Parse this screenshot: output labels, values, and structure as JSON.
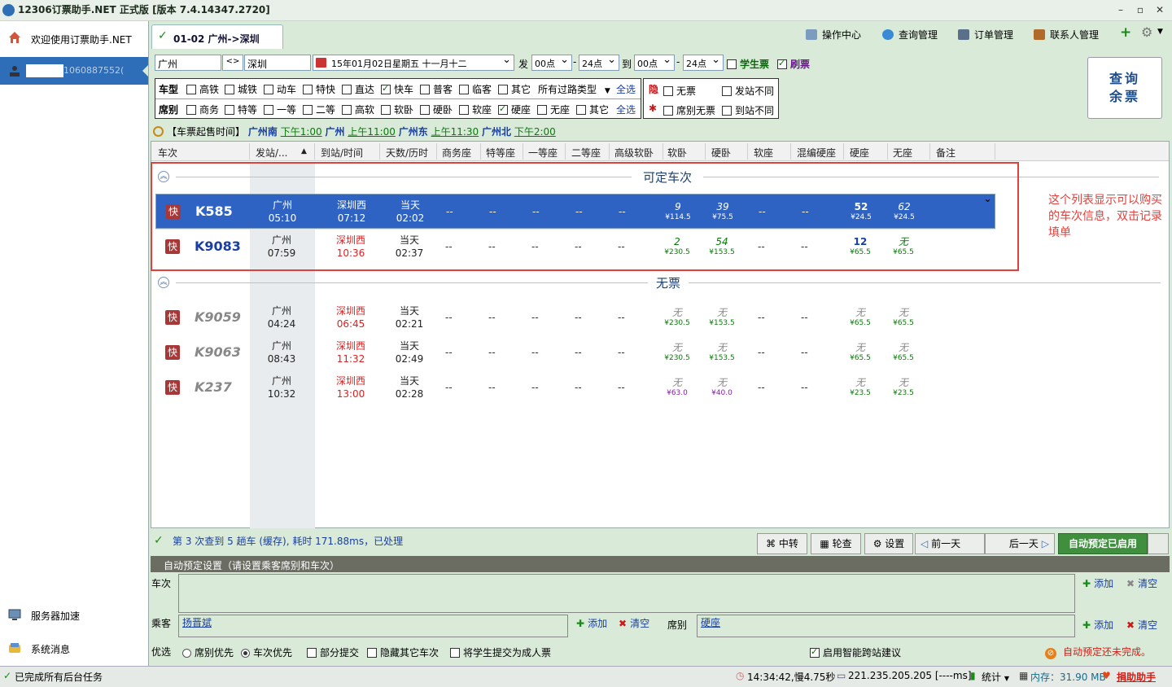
{
  "app": {
    "title": "12306订票助手.NET   正式版 [版本 7.4.14347.2720]"
  },
  "sidebar": {
    "welcome": "欢迎使用订票助手.NET",
    "user_phone": "1060887552(",
    "server_accel": "服务器加速",
    "sys_msg": "系统消息"
  },
  "tab": {
    "label": "01-02 广州->深圳"
  },
  "toolbar": {
    "ops_center": "操作中心",
    "query_mgmt": "查询管理",
    "order_mgmt": "订单管理",
    "contacts_mgmt": "联系人管理"
  },
  "query": {
    "from": "广州",
    "swap": "<>",
    "to": "深圳",
    "date": "15年01月02日星期五  十一月十二",
    "dep_label": "发",
    "dep_start": "00点",
    "dep_end": "24点",
    "arr_label": "到",
    "arr_start": "00点",
    "arr_end": "24点",
    "student": "学生票",
    "refresh": "刷票",
    "button_line1": "查询",
    "button_line2": "余票"
  },
  "filters": {
    "type_label": "车型",
    "types": [
      "高铁",
      "城铁",
      "动车",
      "特快",
      "直达",
      "快车",
      "普客",
      "临客",
      "其它"
    ],
    "transit_type": "所有过路类型",
    "select_all": "全选",
    "seat_label": "席别",
    "seats": [
      "商务",
      "特等",
      "一等",
      "二等",
      "高软",
      "软卧",
      "硬卧",
      "软座",
      "硬座",
      "无座",
      "其它"
    ],
    "hide_label": "隐",
    "opt_no_ticket": "无票",
    "opt_dep_diff": "发站不同",
    "opt_seat_none": "席别无票",
    "opt_arr_diff": "到站不同"
  },
  "sale_info": {
    "prefix": "【车票起售时间】",
    "stations": [
      {
        "name": "广州南",
        "time": "下午1:00"
      },
      {
        "name": "广州",
        "time": "上午11:00"
      },
      {
        "name": "广州东",
        "time": "上午11:30"
      },
      {
        "name": "广州北",
        "time": "下午2:00"
      }
    ]
  },
  "grid": {
    "headers": [
      "车次",
      "发站/...",
      "到站/时间",
      "天数/历时",
      "商务座",
      "特等座",
      "一等座",
      "二等座",
      "高级软卧",
      "软卧",
      "硬卧",
      "软座",
      "混编硬座",
      "硬座",
      "无座",
      "备注"
    ],
    "section_available": "可定车次",
    "section_none": "无票",
    "dash": "--",
    "badge": "快",
    "trains_available": [
      {
        "no": "K585",
        "from": "广州",
        "dep": "05:10",
        "to": "深圳西",
        "arr": "07:12",
        "day": "当天",
        "dur": "02:02",
        "rw": "9",
        "rw_p": "¥114.5",
        "yw": "39",
        "yw_p": "¥75.5",
        "yz": "52",
        "yz_p": "¥24.5",
        "wz": "62",
        "wz_p": "¥24.5"
      },
      {
        "no": "K9083",
        "from": "广州",
        "dep": "07:59",
        "to": "深圳西",
        "arr": "10:36",
        "day": "当天",
        "dur": "02:37",
        "rw": "2",
        "rw_p": "¥230.5",
        "yw": "54",
        "yw_p": "¥153.5",
        "yz": "12",
        "yz_p": "¥65.5",
        "wz": "无",
        "wz_p": "¥65.5"
      }
    ],
    "trains_none": [
      {
        "no": "K9059",
        "from": "广州",
        "dep": "04:24",
        "to": "深圳西",
        "arr": "06:45",
        "day": "当天",
        "dur": "02:21",
        "rw": "无",
        "rw_p": "¥230.5",
        "yw": "无",
        "yw_p": "¥153.5",
        "yz": "无",
        "yz_p": "¥65.5",
        "wz": "无",
        "wz_p": "¥65.5"
      },
      {
        "no": "K9063",
        "from": "广州",
        "dep": "08:43",
        "to": "深圳西",
        "arr": "11:32",
        "day": "当天",
        "dur": "02:49",
        "rw": "无",
        "rw_p": "¥230.5",
        "yw": "无",
        "yw_p": "¥153.5",
        "yz": "无",
        "yz_p": "¥65.5",
        "wz": "无",
        "wz_p": "¥65.5"
      },
      {
        "no": "K237",
        "from": "广州",
        "dep": "10:32",
        "to": "深圳西",
        "arr": "13:00",
        "day": "当天",
        "dur": "02:28",
        "rw": "无",
        "rw_p": "¥63.0",
        "yw": "无",
        "yw_p": "¥40.0",
        "yz": "无",
        "yz_p": "¥23.5",
        "wz": "无",
        "wz_p": "¥23.5"
      }
    ]
  },
  "annotation": "这个列表显示可以购买的车次信息，双击记录填单",
  "grid_status": "第 3 次查到 5 趟车 (缓存), 耗时 171.88ms，已处理",
  "grid_toolbar": {
    "transfer": "中转",
    "round": "轮查",
    "settings": "设置",
    "prev_day": "前一天",
    "next_day": "后一天",
    "auto_book": "自动预定已启用"
  },
  "auto": {
    "header": "自动预定设置（请设置乘客席别和车次）",
    "train_label": "车次",
    "passenger_label": "乘客",
    "passenger_value": "扬晋斌",
    "seat_label": "席别",
    "seat_value": "硬座",
    "add": "添加",
    "clear": "清空",
    "priority_label": "优选",
    "opt_seat_first": "席别优先",
    "opt_train_first": "车次优先",
    "opt_partial": "部分提交",
    "opt_hide_other": "隐藏其它车次",
    "opt_student_adult": "将学生提交为成人票",
    "opt_smart": "启用智能跨站建议",
    "warning": "自动预定还未完成。"
  },
  "statusbar": {
    "left": "已完成所有后台任务",
    "time": "14:34:42,慢4.75秒",
    "ip": "221.235.205.205 [----ms]",
    "stats": "统计",
    "memory": "内存：31.90 MB",
    "donate": "捐助助手"
  },
  "colors": {
    "selected_row": "#2e63c4",
    "annotation": "#e0413c",
    "seat_green": "#0a7a0a",
    "arrival_red": "#e02020"
  }
}
